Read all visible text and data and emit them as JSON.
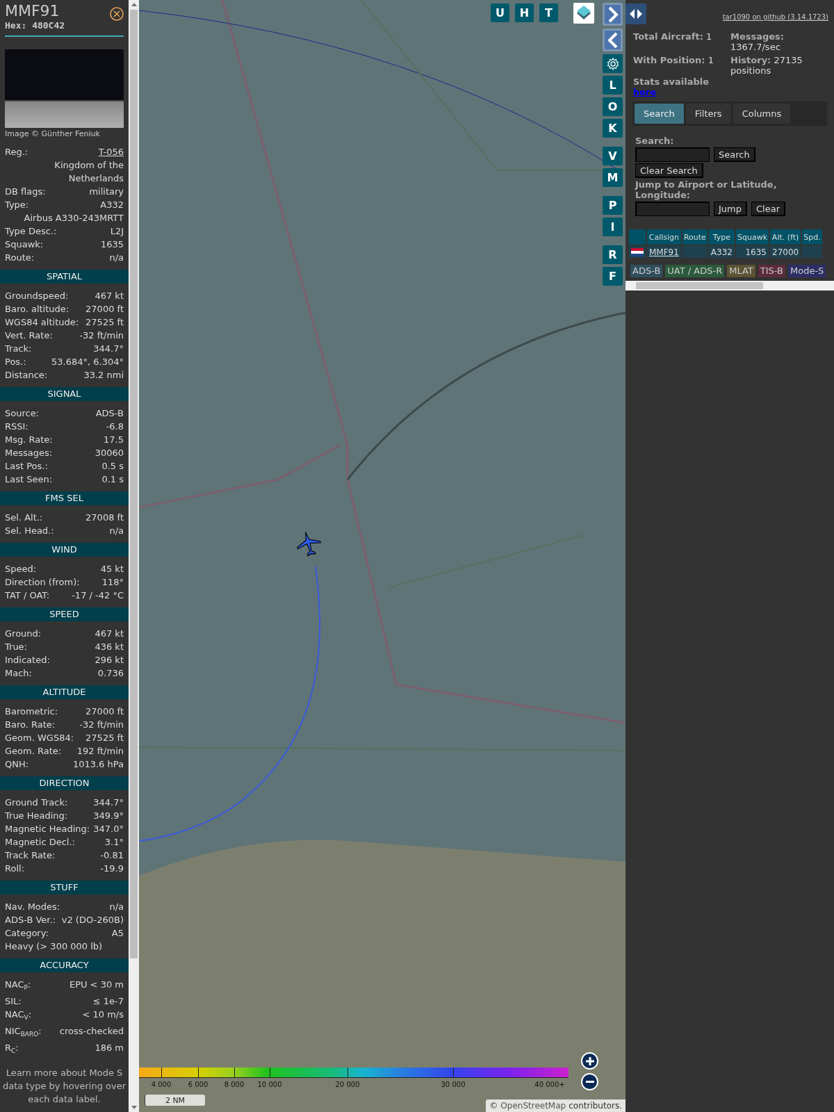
{
  "detail": {
    "callsign": "MMF91",
    "hex": "Hex: 480C42",
    "photo_credit": "Image © Günther Feniuk",
    "rows": [
      {
        "kind": "link",
        "label": "Reg.:",
        "value": "T-056"
      },
      {
        "kind": "value",
        "value": "Kingdom of the Netherlands"
      },
      {
        "kind": "pair",
        "label": "DB flags:",
        "value": "military"
      },
      {
        "kind": "pair",
        "label": "Type:",
        "value": "A332"
      },
      {
        "kind": "value",
        "value": "Airbus A330-243MRTT"
      },
      {
        "kind": "pair",
        "label": "Type Desc.:",
        "value": "L2J"
      },
      {
        "kind": "pair",
        "label": "Squawk:",
        "value": "1635"
      },
      {
        "kind": "pair",
        "label": "Route:",
        "value": "n/a"
      }
    ],
    "sections": [
      {
        "title": "SPATIAL",
        "rows": [
          {
            "kind": "pair",
            "label": "Groundspeed:",
            "value": "467 kt"
          },
          {
            "kind": "pair",
            "label": "Baro. altitude:",
            "value": "27000 ft"
          },
          {
            "kind": "pair",
            "label": "WGS84 altitude:",
            "value": "27525 ft"
          },
          {
            "kind": "pair",
            "label": "Vert. Rate:",
            "value": "-32 ft/min"
          },
          {
            "kind": "pair",
            "label": "Track:",
            "value": "344.7°"
          },
          {
            "kind": "pair",
            "label": "Pos.:",
            "value": "53.684°, 6.304°"
          },
          {
            "kind": "pair",
            "label": "Distance:",
            "value": "33.2 nmi"
          }
        ]
      },
      {
        "title": "SIGNAL",
        "rows": [
          {
            "kind": "pair",
            "label": "Source:",
            "value": "ADS-B"
          },
          {
            "kind": "pair",
            "label": "RSSI:",
            "value": "-6.8"
          },
          {
            "kind": "pair",
            "label": "Msg. Rate:",
            "value": "17.5"
          },
          {
            "kind": "pair",
            "label": "Messages:",
            "value": "30060"
          },
          {
            "kind": "pair",
            "label": "Last Pos.:",
            "value": "0.5 s"
          },
          {
            "kind": "pair",
            "label": "Last Seen:",
            "value": "0.1 s"
          }
        ]
      },
      {
        "title": "FMS SEL",
        "rows": [
          {
            "kind": "pair",
            "label": "Sel. Alt.:",
            "value": "27008 ft"
          },
          {
            "kind": "pair",
            "label": "Sel. Head.:",
            "value": "n/a"
          }
        ]
      },
      {
        "title": "WIND",
        "rows": [
          {
            "kind": "pair",
            "label": "Speed:",
            "value": "45 kt"
          },
          {
            "kind": "pair",
            "label": "Direction (from):",
            "value": "118°"
          },
          {
            "kind": "pair",
            "label": "TAT / OAT:",
            "value": "-17 / -42 °C"
          }
        ]
      },
      {
        "title": "SPEED",
        "rows": [
          {
            "kind": "pair",
            "label": "Ground:",
            "value": "467 kt"
          },
          {
            "kind": "pair",
            "label": "True:",
            "value": "436 kt"
          },
          {
            "kind": "pair",
            "label": "Indicated:",
            "value": "296 kt"
          },
          {
            "kind": "pair",
            "label": "Mach:",
            "value": "0.736"
          }
        ]
      },
      {
        "title": "ALTITUDE",
        "rows": [
          {
            "kind": "pair",
            "label": "Barometric:",
            "value": "27000 ft"
          },
          {
            "kind": "pair",
            "label": "Baro. Rate:",
            "value": "-32 ft/min"
          },
          {
            "kind": "pair",
            "label": "Geom. WGS84:",
            "value": "27525 ft"
          },
          {
            "kind": "pair",
            "label": "Geom. Rate:",
            "value": "192 ft/min"
          },
          {
            "kind": "pair",
            "label": "QNH:",
            "value": "1013.6 hPa"
          }
        ]
      },
      {
        "title": "DIRECTION",
        "rows": [
          {
            "kind": "pair",
            "label": "Ground Track:",
            "value": "344.7°"
          },
          {
            "kind": "pair",
            "label": "True Heading:",
            "value": "349.9°"
          },
          {
            "kind": "pair",
            "label": "Magnetic Heading:",
            "value": "347.0°"
          },
          {
            "kind": "pair",
            "label": "Magnetic Decl.:",
            "value": "3.1°"
          },
          {
            "kind": "pair",
            "label": "Track Rate:",
            "value": "-0.81"
          },
          {
            "kind": "pair",
            "label": "Roll:",
            "value": "-19.9"
          }
        ]
      },
      {
        "title": "STUFF",
        "rows": [
          {
            "kind": "pair",
            "label": "Nav. Modes:",
            "value": "n/a"
          },
          {
            "kind": "pair",
            "label": "ADS-B Ver.:",
            "value": "v2 (DO-260B)"
          },
          {
            "kind": "pair",
            "label": "Category:",
            "value": "A5"
          },
          {
            "kind": "note",
            "value": "Heavy (> 300 000 lb)"
          }
        ]
      },
      {
        "title": "ACCURACY",
        "rows": [
          {
            "kind": "pair",
            "label": "NAC$_{P}$:",
            "value": "EPU < 30 m"
          },
          {
            "kind": "pair",
            "label": "SIL:",
            "value": "≤ 1e-7"
          },
          {
            "kind": "pair",
            "label": "NAC$_{V}$:",
            "value": "< 10 m/s"
          },
          {
            "kind": "pair",
            "label": "NIC$_{BARO}$:",
            "value": "cross-checked"
          },
          {
            "kind": "pair",
            "label": "R$_{C}$:",
            "value": "186 m"
          }
        ]
      }
    ],
    "footer": "Learn more about Mode S data type by hovering over each data label."
  },
  "map": {
    "top_buttons": [
      "U",
      "H",
      "T"
    ],
    "side_buttons": [
      {
        "kind": "arrow-right"
      },
      {
        "kind": "arrow-left"
      },
      {
        "kind": "gear"
      },
      {
        "kind": "letter",
        "label": "L"
      },
      {
        "kind": "letter",
        "label": "O"
      },
      {
        "kind": "letter",
        "label": "K"
      },
      {
        "kind": "letter",
        "label": "V"
      },
      {
        "kind": "letter",
        "label": "M"
      },
      {
        "kind": "letter",
        "label": "P"
      },
      {
        "kind": "letter",
        "label": "I"
      },
      {
        "kind": "letter",
        "label": "R"
      },
      {
        "kind": "letter",
        "label": "F"
      }
    ],
    "altitude_ticks": [
      "4 000",
      "6 000",
      "8 000",
      "10 000",
      "20 000",
      "30 000",
      "40 000+"
    ],
    "scale": "2 NM",
    "attribution_link": "OpenStreetMap",
    "attribution_prefix": "©",
    "attribution_suffix": "contributors."
  },
  "panel": {
    "version_link": "tar1090 on github (3.14.1723)",
    "stats": [
      {
        "label": "Total Aircraft:",
        "value": "1"
      },
      {
        "label": "Messages:",
        "value": "1367.7/sec"
      },
      {
        "label": "With Position:",
        "value": "1"
      },
      {
        "label": "History:",
        "value": "27135 positions"
      }
    ],
    "stats_note": "Stats available",
    "stats_link": "here",
    "tabs": [
      {
        "label": "Search",
        "selected": true
      },
      {
        "label": "Filters",
        "selected": false
      },
      {
        "label": "Columns",
        "selected": false
      }
    ],
    "search": {
      "label": "Search:",
      "button": "Search",
      "clear_button": "Clear Search",
      "jump_label": "Jump to Airport or Latitude, Longitude:",
      "jump_button": "Jump",
      "jump_clear_button": "Clear"
    },
    "table": {
      "columns": [
        "Callsign",
        "Route",
        "Type",
        "Squawk",
        "Alt. (ft)",
        "Spd."
      ],
      "rows": [
        {
          "callsign": "MMF91",
          "type": "A332",
          "squawk": "1635",
          "altitude": "27000"
        }
      ]
    },
    "legend": [
      {
        "label": "ADS-B",
        "color": "#2f4f5f"
      },
      {
        "label": "UAT / ADS-R",
        "color": "#2c5a3c"
      },
      {
        "label": "MLAT",
        "color": "#5c5434"
      },
      {
        "label": "TIS-B",
        "color": "#5c2c3c"
      },
      {
        "label": "Mode-S",
        "color": "#2e2e66"
      }
    ]
  }
}
